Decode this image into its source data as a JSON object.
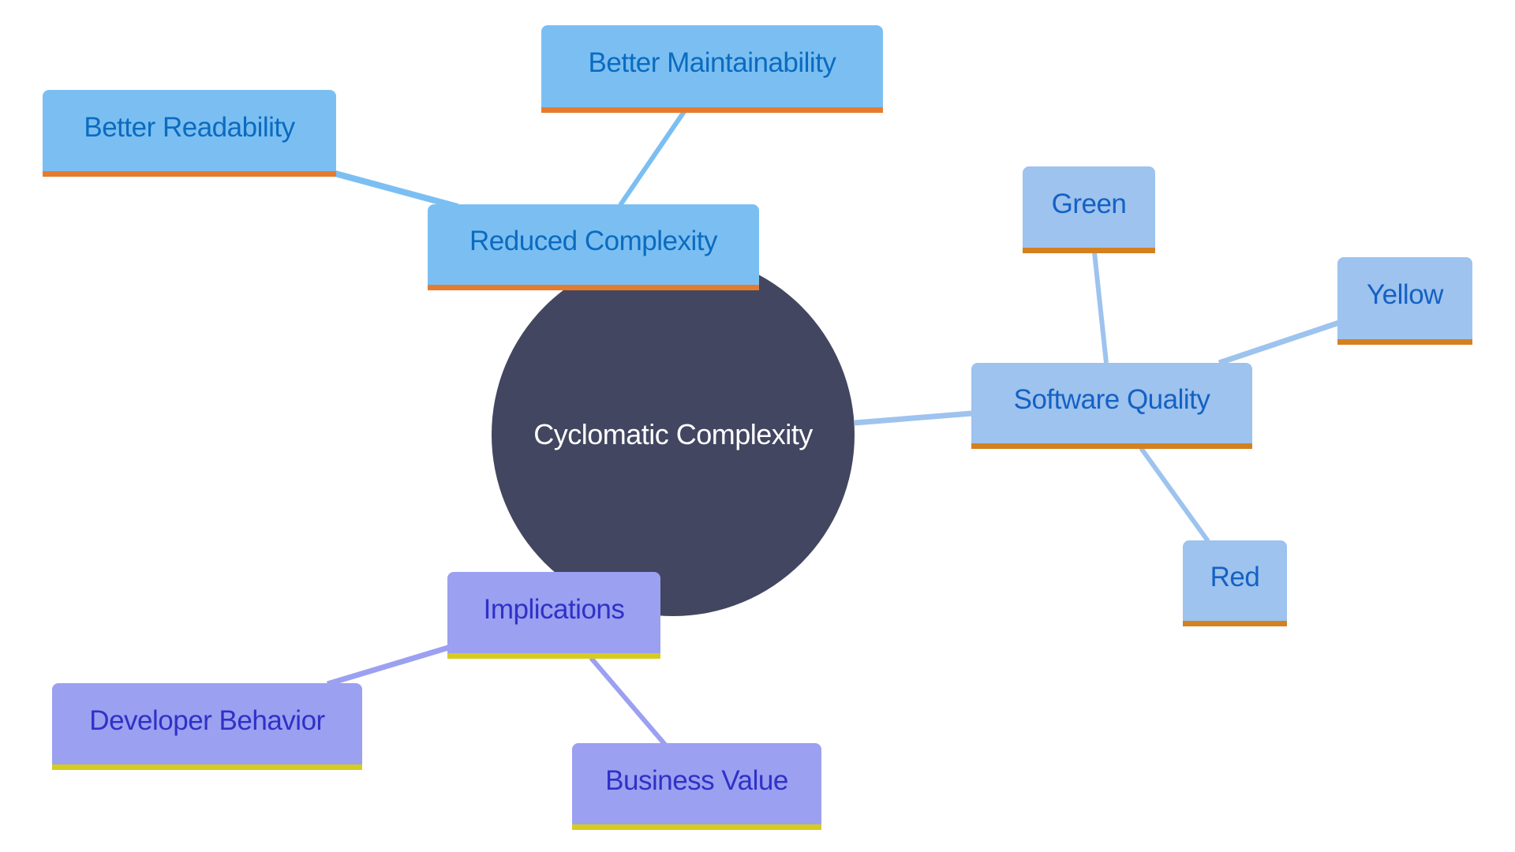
{
  "diagram": {
    "type": "mindmap",
    "root": {
      "id": "root",
      "label": "Cyclomatic Complexity",
      "color": "#424660",
      "text_color": "#ffffff"
    },
    "branches": [
      {
        "id": "reduced",
        "label": "Reduced Complexity",
        "fill": "#7BBFF2",
        "text_color": "#0B6BBF",
        "underline": "#E67B2E",
        "edge_color": "#7BBFF2",
        "children": [
          {
            "id": "readability",
            "label": "Better Readability"
          },
          {
            "id": "maintainability",
            "label": "Better Maintainability"
          }
        ]
      },
      {
        "id": "quality",
        "label": "Software Quality",
        "fill": "#9DC3EE",
        "text_color": "#1561C4",
        "underline": "#D4801F",
        "edge_color": "#9DC3EE",
        "children": [
          {
            "id": "green",
            "label": "Green"
          },
          {
            "id": "yellow",
            "label": "Yellow"
          },
          {
            "id": "red",
            "label": "Red"
          }
        ]
      },
      {
        "id": "implications",
        "label": "Implications",
        "fill": "#9BA0F1",
        "text_color": "#2F31C6",
        "underline": "#D6CC1F",
        "edge_color": "#9BA0F1",
        "children": [
          {
            "id": "developer",
            "label": "Developer Behavior"
          },
          {
            "id": "business",
            "label": "Business Value"
          }
        ]
      }
    ]
  }
}
